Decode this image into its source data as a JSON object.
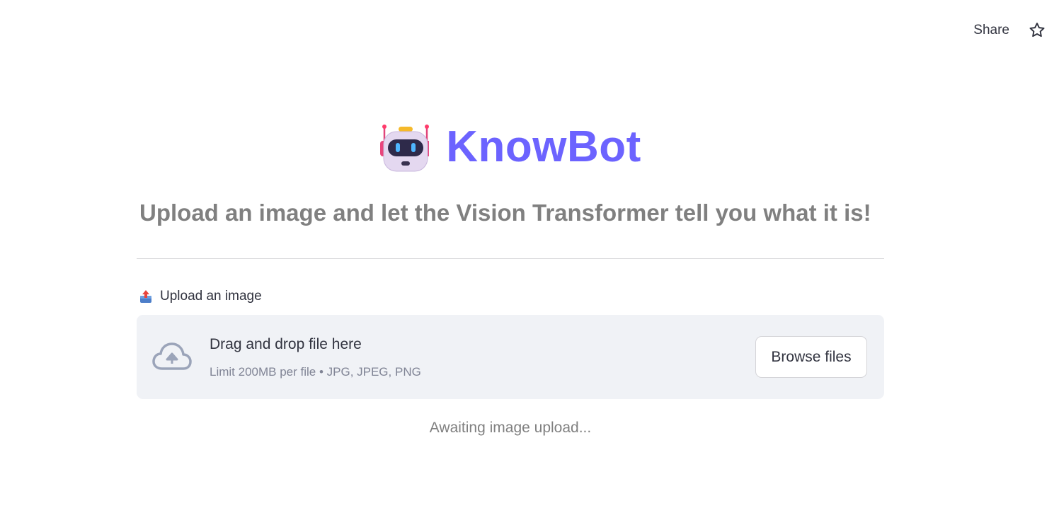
{
  "header": {
    "share_label": "Share",
    "star_icon": "star-icon"
  },
  "app": {
    "title": "KnowBot",
    "title_icon": "robot-icon",
    "subtitle": "Upload an image and let the Vision Transformer tell you what it is!"
  },
  "uploader": {
    "label_icon": "outbox-tray-icon",
    "label": "Upload an image",
    "dropzone_icon": "cloud-upload-icon",
    "dropzone_title": "Drag and drop file here",
    "dropzone_limit": "Limit 200MB per file • JPG, JPEG, PNG",
    "browse_label": "Browse files"
  },
  "status": {
    "text": "Awaiting image upload..."
  },
  "colors": {
    "accent": "#6c63ff",
    "subtitle": "#808080",
    "dropzone_bg": "#f0f2f6",
    "text": "#31333f"
  }
}
